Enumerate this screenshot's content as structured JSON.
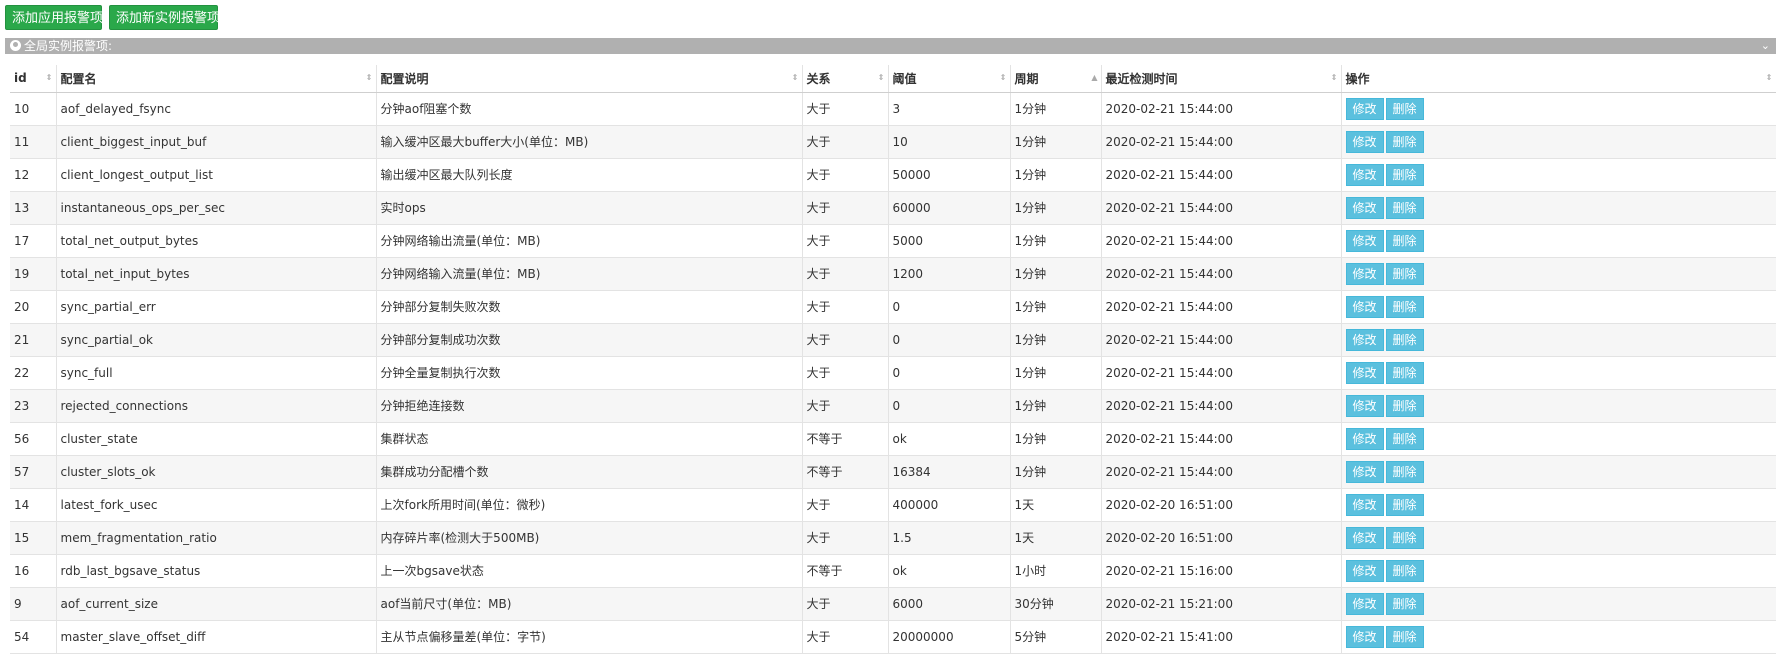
{
  "toolbar": {
    "add_app_alert": "添加应用报警项",
    "add_instance_alert": "添加新实例报警项",
    "plus_icon": "plus-icon"
  },
  "section": {
    "title": "全局实例报警项:",
    "icon": "globe-icon",
    "collapse_icon": "chevron-down-icon"
  },
  "table": {
    "headers": [
      "id",
      "配置名",
      "配置说明",
      "关系",
      "阈值",
      "周期",
      "最近检测时间",
      "操作"
    ],
    "edit_label": "修改",
    "delete_label": "删除",
    "rows": [
      {
        "id": "10",
        "name": "aof_delayed_fsync",
        "desc": "分钟aof阻塞个数",
        "relation": "大于",
        "threshold": "3",
        "period": "1分钟",
        "last_check": "2020-02-21 15:44:00"
      },
      {
        "id": "11",
        "name": "client_biggest_input_buf",
        "desc": "输入缓冲区最大buffer大小(单位：MB)",
        "relation": "大于",
        "threshold": "10",
        "period": "1分钟",
        "last_check": "2020-02-21 15:44:00"
      },
      {
        "id": "12",
        "name": "client_longest_output_list",
        "desc": "输出缓冲区最大队列长度",
        "relation": "大于",
        "threshold": "50000",
        "period": "1分钟",
        "last_check": "2020-02-21 15:44:00"
      },
      {
        "id": "13",
        "name": "instantaneous_ops_per_sec",
        "desc": "实时ops",
        "relation": "大于",
        "threshold": "60000",
        "period": "1分钟",
        "last_check": "2020-02-21 15:44:00"
      },
      {
        "id": "17",
        "name": "total_net_output_bytes",
        "desc": "分钟网络输出流量(单位：MB)",
        "relation": "大于",
        "threshold": "5000",
        "period": "1分钟",
        "last_check": "2020-02-21 15:44:00"
      },
      {
        "id": "19",
        "name": "total_net_input_bytes",
        "desc": "分钟网络输入流量(单位：MB)",
        "relation": "大于",
        "threshold": "1200",
        "period": "1分钟",
        "last_check": "2020-02-21 15:44:00"
      },
      {
        "id": "20",
        "name": "sync_partial_err",
        "desc": "分钟部分复制失败次数",
        "relation": "大于",
        "threshold": "0",
        "period": "1分钟",
        "last_check": "2020-02-21 15:44:00"
      },
      {
        "id": "21",
        "name": "sync_partial_ok",
        "desc": "分钟部分复制成功次数",
        "relation": "大于",
        "threshold": "0",
        "period": "1分钟",
        "last_check": "2020-02-21 15:44:00"
      },
      {
        "id": "22",
        "name": "sync_full",
        "desc": "分钟全量复制执行次数",
        "relation": "大于",
        "threshold": "0",
        "period": "1分钟",
        "last_check": "2020-02-21 15:44:00"
      },
      {
        "id": "23",
        "name": "rejected_connections",
        "desc": "分钟拒绝连接数",
        "relation": "大于",
        "threshold": "0",
        "period": "1分钟",
        "last_check": "2020-02-21 15:44:00"
      },
      {
        "id": "56",
        "name": "cluster_state",
        "desc": "集群状态",
        "relation": "不等于",
        "threshold": "ok",
        "period": "1分钟",
        "last_check": "2020-02-21 15:44:00"
      },
      {
        "id": "57",
        "name": "cluster_slots_ok",
        "desc": "集群成功分配槽个数",
        "relation": "不等于",
        "threshold": "16384",
        "period": "1分钟",
        "last_check": "2020-02-21 15:44:00"
      },
      {
        "id": "14",
        "name": "latest_fork_usec",
        "desc": "上次fork所用时间(单位：微秒)",
        "relation": "大于",
        "threshold": "400000",
        "period": "1天",
        "last_check": "2020-02-20 16:51:00"
      },
      {
        "id": "15",
        "name": "mem_fragmentation_ratio",
        "desc": "内存碎片率(检测大于500MB)",
        "relation": "大于",
        "threshold": "1.5",
        "period": "1天",
        "last_check": "2020-02-20 16:51:00"
      },
      {
        "id": "16",
        "name": "rdb_last_bgsave_status",
        "desc": "上一次bgsave状态",
        "relation": "不等于",
        "threshold": "ok",
        "period": "1小时",
        "last_check": "2020-02-21 15:16:00"
      },
      {
        "id": "9",
        "name": "aof_current_size",
        "desc": "aof当前尺寸(单位：MB)",
        "relation": "大于",
        "threshold": "6000",
        "period": "30分钟",
        "last_check": "2020-02-21 15:21:00"
      },
      {
        "id": "54",
        "name": "master_slave_offset_diff",
        "desc": "主从节点偏移量差(单位：字节)",
        "relation": "大于",
        "threshold": "20000000",
        "period": "5分钟",
        "last_check": "2020-02-21 15:41:00"
      }
    ]
  }
}
